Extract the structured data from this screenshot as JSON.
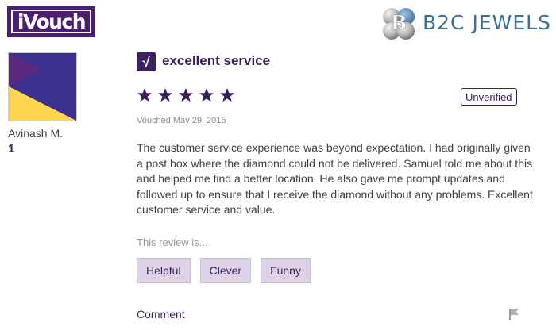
{
  "brand": {
    "ivouch_logo_text": "iVouch",
    "partner_logo_text": "B2C JEWELS",
    "partner_monogram": "B"
  },
  "reviewer": {
    "name": "Avinash M.",
    "review_count": "1",
    "avatar_colors": [
      "#3a3190",
      "#ffd54f",
      "#5b2a80"
    ]
  },
  "review": {
    "title": "excellent service",
    "check_glyph": "√",
    "rating": 5,
    "max_rating": 5,
    "star_color": "#3a1f5c",
    "verification_status": "Unverified",
    "vouched_date": "Vouched May 29, 2015",
    "body": "The customer service experience was beyond expectation. I had originally given a post box where the diamond could not be delivered. Samuel told me about this and helped me find a better location. He also gave me prompt updates and followed up to ensure that I receive the diamond without any problems. Excellent customer service and value."
  },
  "feedback": {
    "prompt": "This review is...",
    "buttons": [
      "Helpful",
      "Clever",
      "Funny"
    ]
  },
  "actions": {
    "comment_label": "Comment",
    "flag_icon": "flag-icon"
  },
  "colors": {
    "brand_purple": "#3a1f5c",
    "button_bg": "#dcd3e6",
    "partner_blue": "#3d6f99"
  }
}
